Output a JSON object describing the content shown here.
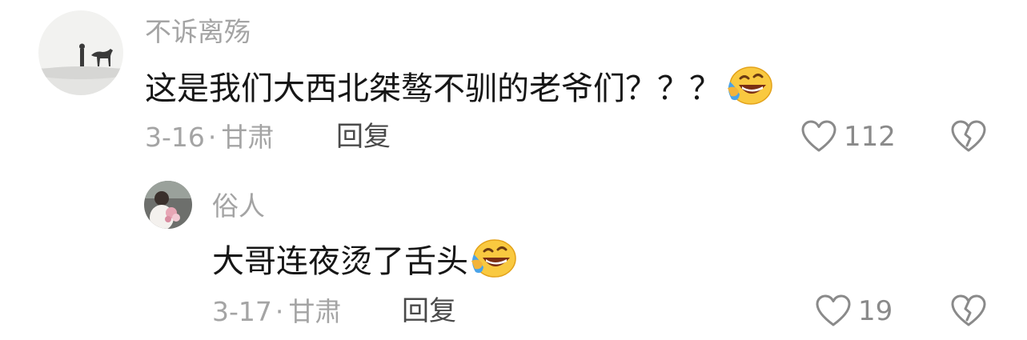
{
  "comments": [
    {
      "username": "不诉离殇",
      "text": "这是我们大西北桀骜不驯的老爷们？？？",
      "emoji": "laughing-crying-emoji",
      "date": "3-16",
      "location": "甘肃",
      "reply_label": "回复",
      "like_count": "112"
    },
    {
      "username": "俗人",
      "text": "大哥连夜烫了舌头",
      "emoji": "laughing-crying-emoji",
      "date": "3-17",
      "location": "甘肃",
      "reply_label": "回复",
      "like_count": "19"
    }
  ],
  "icons": {
    "like": "heart-outline-icon",
    "dislike": "broken-heart-icon"
  },
  "colors": {
    "text_primary": "#161616",
    "text_secondary": "#a4a4a4",
    "reply": "#4a4a4a"
  }
}
